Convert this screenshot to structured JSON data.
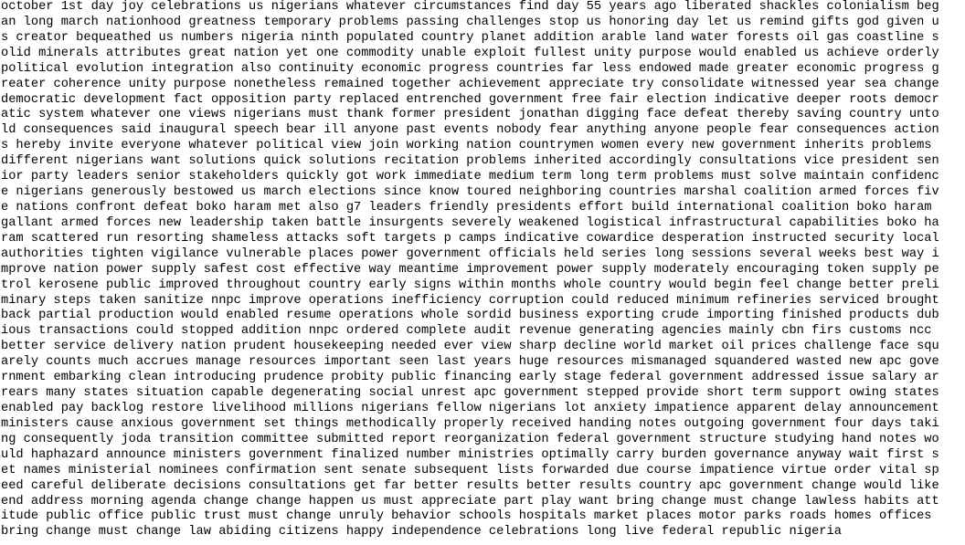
{
  "document": {
    "lines": [
      "october 1st day joy celebrations us nigerians whatever circumstances find day 55 years ago liberated shackles colonialism beg",
      "an long march nationhood greatness temporary problems passing challenges stop us honoring day let us remind gifts god given u",
      "s creator bequeathed us numbers nigeria ninth populated country planet addition arable land water forests oil gas coastline s",
      "olid minerals attributes great nation yet one commodity unable exploit fullest unity purpose would enabled us achieve orderly",
      "political evolution integration also continuity economic progress countries far less endowed made greater economic progress g",
      "reater coherence unity purpose nonetheless remained together achievement appreciate try consolidate witnessed year sea change",
      "democratic development fact opposition party replaced entrenched government free fair election indicative deeper roots democr",
      "atic system whatever one views nigerians must thank former president jonathan digging face defeat thereby saving country unto",
      "ld consequences said inaugural speech bear ill anyone past events nobody fear anything anyone people fear consequences action",
      "s hereby invite everyone whatever political view join working nation countrymen women every new government inherits problems",
      "different nigerians want solutions quick solutions recitation problems inherited accordingly consultations vice president sen",
      "ior party leaders senior stakeholders quickly got work immediate medium term long term problems must solve maintain confidenc",
      "e nigerians generously bestowed us march elections since know toured neighboring countries marshal coalition armed forces fiv",
      "e nations confront defeat boko haram met also g7 leaders friendly presidents effort build international coalition boko haram",
      "gallant armed forces new leadership taken battle insurgents severely weakened logistical infrastructural capabilities boko ha",
      "ram scattered run resorting shameless attacks soft targets p camps indicative cowardice desperation instructed security local",
      "authorities tighten vigilance vulnerable places power government officials held series long sessions several weeks best way i",
      "mprove nation power supply safest cost effective way meantime improvement power supply moderately encouraging token supply pe",
      "trol kerosene public improved throughout country early signs within months whole country would begin feel change better preli",
      "minary steps taken sanitize nnpc improve operations inefficiency corruption could reduced minimum refineries serviced brought",
      "back partial production would enabled resume operations whole sordid business exporting crude importing finished products dub",
      "ious transactions could stopped addition nnpc ordered complete audit revenue generating agencies mainly cbn firs customs ncc",
      "better service delivery nation prudent housekeeping needed ever view sharp decline world market oil prices challenge face squ",
      "arely counts much accrues manage resources important seen last years huge resources mismanaged squandered wasted new apc gove",
      "rnment embarking clean introducing prudence probity public financing early stage federal government addressed issue salary ar",
      "rears many states situation capable degenerating social unrest apc government stepped provide short term support owing states",
      "enabled pay backlog restore livelihood millions nigerians fellow nigerians lot anxiety impatience apparent delay announcement",
      "ministers cause anxious government set things methodically properly received handing notes outgoing government four days taki",
      "ng consequently joda transition committee submitted report reorganization federal government structure studying hand notes wo",
      "uld haphazard announce ministers government finalized number ministries optimally carry burden governance anyway wait first s",
      "et names ministerial nominees confirmation sent senate subsequent lists forwarded due course impatience virtue order vital sp",
      "eed careful deliberate decisions consultations get far better results better results country apc government change would like",
      "end address morning agenda change change happen us must appreciate part play want bring change must change lawless habits att",
      "itude public office public trust must change unruly behavior schools hospitals market places motor parks roads homes offices",
      "bring change must change law abiding citizens happy independence celebrations long live federal republic nigeria"
    ]
  }
}
